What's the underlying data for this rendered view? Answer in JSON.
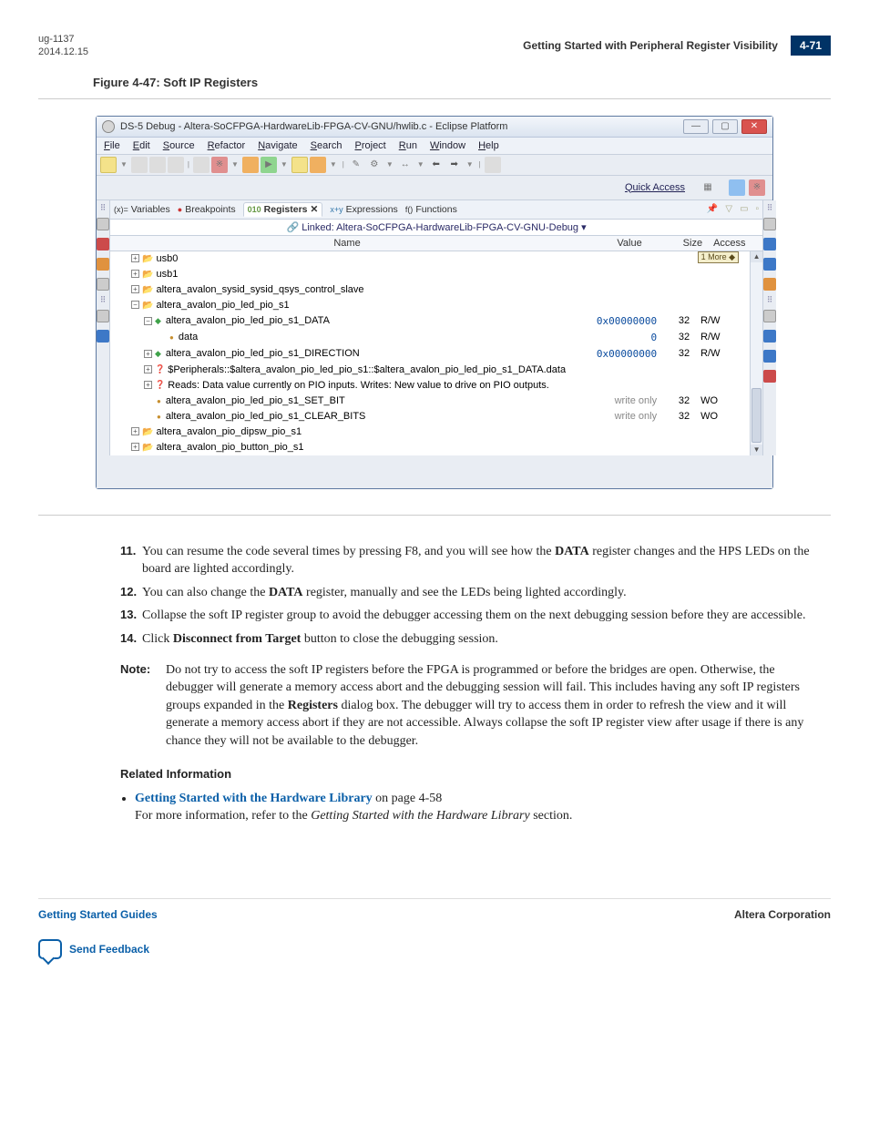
{
  "doc_header": {
    "doc_id": "ug-1137",
    "doc_date": "2014.12.15",
    "section_title": "Getting Started with Peripheral Register Visibility",
    "page_num": "4-71"
  },
  "figure_caption": "Figure 4-47: Soft IP Registers",
  "window": {
    "title": "DS-5 Debug - Altera-SoCFPGA-HardwareLib-FPGA-CV-GNU/hwlib.c - Eclipse Platform",
    "menus": [
      "File",
      "Edit",
      "Source",
      "Refactor",
      "Navigate",
      "Search",
      "Project",
      "Run",
      "Window",
      "Help"
    ],
    "quick_access": "Quick Access",
    "tabs": {
      "variables": "Variables",
      "breakpoints": "Breakpoints",
      "registers": "Registers",
      "expressions": "Expressions",
      "functions": "Functions"
    },
    "linked": "Linked: Altera-SoCFPGA-HardwareLib-FPGA-CV-GNU-Debug ▾",
    "columns": {
      "name": "Name",
      "value": "Value",
      "size": "Size",
      "access": "Access"
    },
    "more_badge": "1 More ◆",
    "rows": [
      {
        "indent": 1,
        "exp": "+",
        "icon": "folder",
        "label": "usb0",
        "value": "",
        "size": "",
        "access": ""
      },
      {
        "indent": 1,
        "exp": "+",
        "icon": "folder",
        "label": "usb1",
        "value": "",
        "size": "",
        "access": ""
      },
      {
        "indent": 1,
        "exp": "+",
        "icon": "folder",
        "label": "altera_avalon_sysid_sysid_qsys_control_slave",
        "value": "",
        "size": "",
        "access": ""
      },
      {
        "indent": 1,
        "exp": "-",
        "icon": "folder",
        "label": "altera_avalon_pio_led_pio_s1",
        "value": "",
        "size": "",
        "access": ""
      },
      {
        "indent": 2,
        "exp": "-",
        "icon": "green",
        "label": "altera_avalon_pio_led_pio_s1_DATA",
        "value": "0x00000000",
        "size": "32",
        "access": "R/W"
      },
      {
        "indent": 3,
        "exp": "",
        "icon": "dot",
        "label": "data",
        "value": "0",
        "size": "32",
        "access": "R/W"
      },
      {
        "indent": 2,
        "exp": "+",
        "icon": "green",
        "label": "altera_avalon_pio_led_pio_s1_DIRECTION",
        "value": "0x00000000",
        "size": "32",
        "access": "R/W"
      },
      {
        "indent": 2,
        "exp": "+",
        "icon": "info",
        "label": "$Peripherals::$altera_avalon_pio_led_pio_s1::$altera_avalon_pio_led_pio_s1_DATA.data",
        "value": "",
        "size": "",
        "access": ""
      },
      {
        "indent": 2,
        "exp": "+",
        "icon": "info",
        "label": "Reads: Data value currently on PIO inputs. Writes: New value to drive on PIO outputs.",
        "value": "",
        "size": "",
        "access": ""
      },
      {
        "indent": 2,
        "exp": "",
        "icon": "dot",
        "label": "altera_avalon_pio_led_pio_s1_SET_BIT",
        "value": "write only",
        "valgrey": true,
        "size": "32",
        "access": "WO"
      },
      {
        "indent": 2,
        "exp": "",
        "icon": "dot",
        "label": "altera_avalon_pio_led_pio_s1_CLEAR_BITS",
        "value": "write only",
        "valgrey": true,
        "size": "32",
        "access": "WO"
      },
      {
        "indent": 1,
        "exp": "+",
        "icon": "folder",
        "label": "altera_avalon_pio_dipsw_pio_s1",
        "value": "",
        "size": "",
        "access": ""
      },
      {
        "indent": 1,
        "exp": "+",
        "icon": "folder",
        "label": "altera_avalon_pio_button_pio_s1",
        "value": "",
        "size": "",
        "access": ""
      }
    ]
  },
  "steps": [
    {
      "num": "11.",
      "html": "You can resume the code several times by pressing F8, and you will see how the <b>DATA</b> register changes and the HPS LEDs on the board are lighted accordingly."
    },
    {
      "num": "12.",
      "html": "You can also change the <b>DATA</b> register, manually and see the LEDs being lighted accordingly."
    },
    {
      "num": "13.",
      "html": "Collapse the soft IP register group to avoid the debugger accessing them on the next debugging session before they are accessible."
    },
    {
      "num": "14.",
      "html": "Click <b>Disconnect from Target</b> button to close the debugging session."
    }
  ],
  "note_label": "Note:",
  "note_body": "Do not try to access the soft IP registers before the FPGA is programmed or before the bridges are open. Otherwise, the debugger will generate a memory access abort and the debugging session will fail. This includes having any soft IP registers groups expanded in the <b>Registers</b> dialog box. The debugger will try to access them in order to refresh the view and it will generate a memory access abort if they are not accessible. Always collapse the soft IP register view after usage if there is any chance they will not be available to the debugger.",
  "related_title": "Related Information",
  "related_link": "Getting Started with the Hardware Library",
  "related_suffix": " on page 4-58",
  "related_desc": "For more information, refer to the <em>Getting Started with the Hardware Library</em> section.",
  "footer": {
    "left": "Getting Started Guides",
    "right": "Altera Corporation",
    "feedback": "Send Feedback"
  }
}
